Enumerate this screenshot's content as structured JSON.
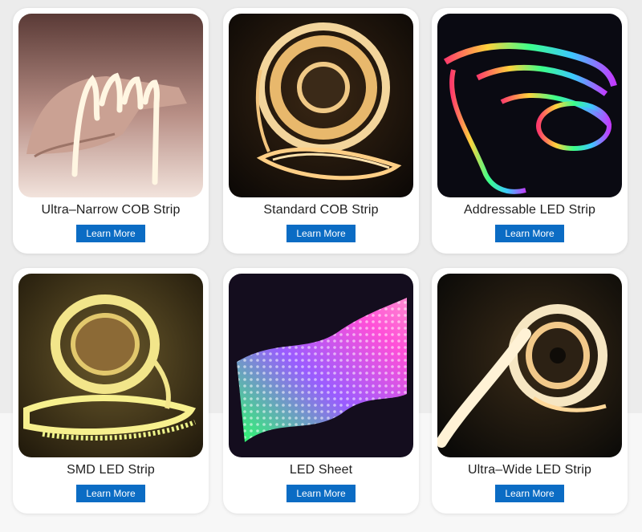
{
  "products": [
    {
      "title": "Ultra–Narrow COB Strip",
      "button": "Learn More",
      "image": "ultra-narrow-cob-strip-photo"
    },
    {
      "title": "Standard COB Strip",
      "button": "Learn More",
      "image": "standard-cob-strip-photo"
    },
    {
      "title": "Addressable LED Strip",
      "button": "Learn More",
      "image": "addressable-led-strip-photo"
    },
    {
      "title": "SMD LED Strip",
      "button": "Learn More",
      "image": "smd-led-strip-photo"
    },
    {
      "title": "LED Sheet",
      "button": "Learn More",
      "image": "led-sheet-photo"
    },
    {
      "title": "Ultra–Wide LED Strip",
      "button": "Learn More",
      "image": "ultra-wide-led-strip-photo"
    }
  ],
  "colors": {
    "button": "#0b6cc4",
    "card": "#ffffff",
    "background": "#ececec"
  }
}
